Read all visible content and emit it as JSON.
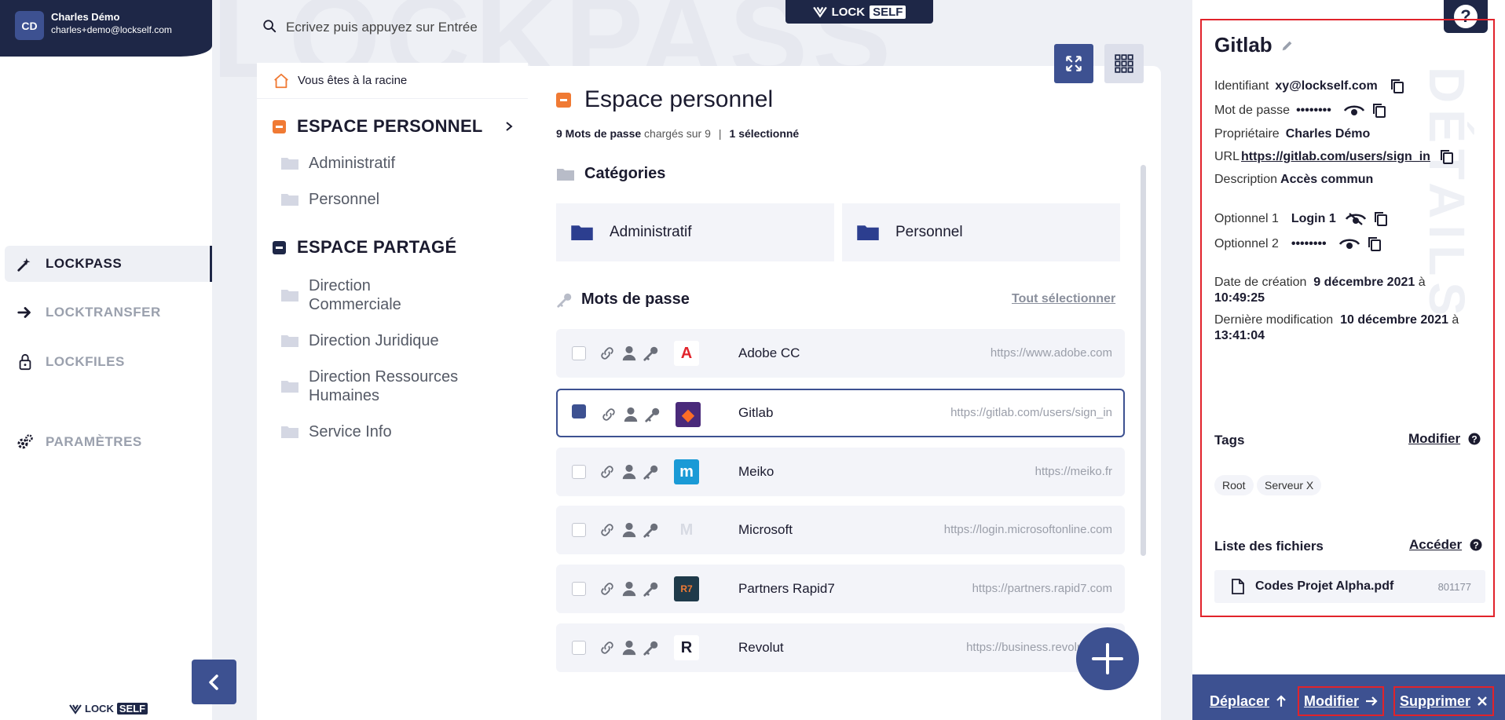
{
  "user": {
    "initials": "CD",
    "name": "Charles Démo",
    "email": "charles+demo@lockself.com"
  },
  "nav": [
    {
      "label": "LOCKPASS",
      "icon": "key-wand-icon",
      "active": true
    },
    {
      "label": "LOCKTRANSFER",
      "icon": "arrow-right-icon",
      "active": false
    },
    {
      "label": "LOCKFILES",
      "icon": "lock-icon",
      "active": false
    },
    {
      "label": "PARAMÈTRES",
      "icon": "gears-icon",
      "active": false
    }
  ],
  "brand": {
    "lock": "LOCK",
    "self": "SELF"
  },
  "watermark": "LOCKPASS",
  "search": {
    "placeholder": "Ecrivez puis appuyez sur Entrée"
  },
  "tree": {
    "breadcrumb": "Vous êtes à la racine",
    "personal_title": "ESPACE PERSONNEL",
    "personal_folders": [
      "Administratif",
      "Personnel"
    ],
    "shared_title": "ESPACE PARTAGÉ",
    "shared_folders": [
      {
        "line1": "Direction",
        "line2": "Commerciale"
      },
      {
        "line1": "Direction Juridique",
        "line2": ""
      },
      {
        "line1": "Direction Ressources",
        "line2": "Humaines"
      },
      {
        "line1": "Service Info",
        "line2": ""
      }
    ]
  },
  "main": {
    "title": "Espace personnel",
    "count_bold": "9 Mots de passe",
    "count_text": " chargés sur 9",
    "selected_text": "1 sélectionné",
    "categories_title": "Catégories",
    "categories": [
      "Administratif",
      "Personnel"
    ],
    "passwords_title": "Mots de passe",
    "select_all": "Tout sélectionner",
    "passwords": [
      {
        "name": "Adobe CC",
        "url": "https://www.adobe.com",
        "logo_text": "A",
        "logo_bg": "#ffffff",
        "logo_fg": "#e1232b",
        "selected": false
      },
      {
        "name": "Gitlab",
        "url": "https://gitlab.com/users/sign_in",
        "logo_text": "◆",
        "logo_bg": "#4a2a7a",
        "logo_fg": "#fc6d26",
        "selected": true
      },
      {
        "name": "Meiko",
        "url": "https://meiko.fr",
        "logo_text": "m",
        "logo_bg": "#1a9ad6",
        "logo_fg": "#ffffff",
        "selected": false
      },
      {
        "name": "Microsoft",
        "url": "https://login.microsoftonline.com",
        "logo_text": "M",
        "logo_bg": "transparent",
        "logo_fg": "#d7dae3",
        "selected": false
      },
      {
        "name": "Partners Rapid7",
        "url": "https://partners.rapid7.com",
        "logo_text": "R7",
        "logo_bg": "#1f3a4a",
        "logo_fg": "#f07a34",
        "selected": false
      },
      {
        "name": "Revolut",
        "url": "https://business.revolut.com",
        "logo_text": "R",
        "logo_bg": "#ffffff",
        "logo_fg": "#1b1b2f",
        "selected": false
      }
    ]
  },
  "details": {
    "watermark": "DÉTAILS",
    "title": "Gitlab",
    "identifiant_label": "Identifiant",
    "identifiant_value": "xy@lockself.com",
    "password_label": "Mot de passe",
    "password_value": "••••••••",
    "owner_label": "Propriétaire",
    "owner_value": "Charles Démo",
    "url_label": "URL",
    "url_value": "https://gitlab.com/users/sign_in",
    "description_label": "Description",
    "description_value": "Accès commun",
    "opt1_label": "Optionnel 1",
    "opt1_value": "Login 1",
    "opt2_label": "Optionnel 2",
    "opt2_value": "••••••••",
    "created_label": "Date de création",
    "created_date": "9 décembre 2021",
    "created_at": "à",
    "created_time": "10:49:25",
    "modified_label": "Dernière modification",
    "modified_date": "10 décembre 2021",
    "modified_at": "à",
    "modified_time": "13:41:04",
    "tags_title": "Tags",
    "tags_link": "Modifier",
    "tags": [
      "Root",
      "Serveur X"
    ],
    "files_title": "Liste des fichiers",
    "files_link": "Accéder",
    "file_name": "Codes Projet Alpha.pdf",
    "file_size": "801177"
  },
  "actions": {
    "move": "Déplacer",
    "edit": "Modifier",
    "delete": "Supprimer"
  },
  "colors": {
    "navy": "#1e2747",
    "primary": "#3d5191",
    "orange": "#f07a34",
    "highlight_red": "#e1232b"
  }
}
